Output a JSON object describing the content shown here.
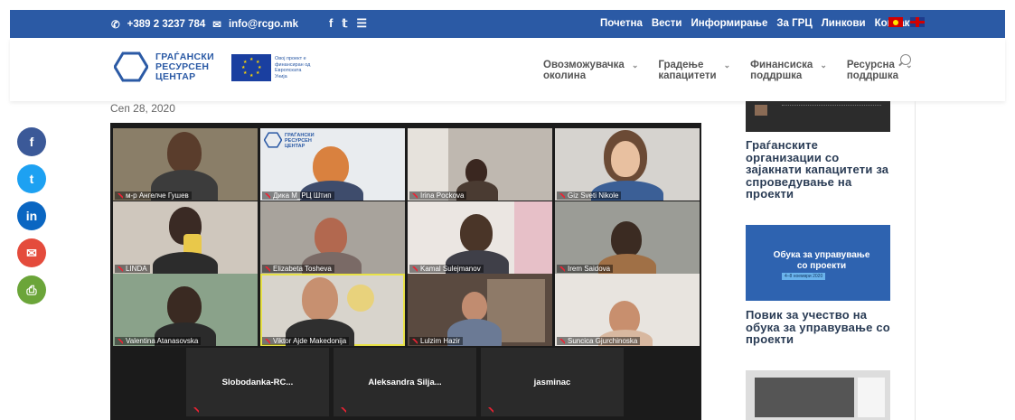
{
  "topbar": {
    "phone": "+389 2 3237 784",
    "email": "info@rcgo.mk",
    "social_icons": [
      "facebook-icon",
      "twitter-icon",
      "rss-icon"
    ],
    "menu": [
      "Почетна",
      "Вести",
      "Информирање",
      "За ГРЦ",
      "Линкови",
      "Контакт"
    ]
  },
  "header": {
    "logo_lines": [
      "ГРАЃАНСКИ",
      "РЕСУРСЕН",
      "ЦЕНТАР"
    ],
    "eu_text": "Овој проект е финансиран од Европската Унија",
    "nav": [
      {
        "line1": "Овозможувачка",
        "line2": "околина"
      },
      {
        "line1": "Градење",
        "line2": "капацитети"
      },
      {
        "line1": "Финансиска",
        "line2": "поддршка"
      },
      {
        "line1": "Ресурсна",
        "line2": "поддршка"
      }
    ]
  },
  "post": {
    "date": "Сеп 28, 2020"
  },
  "video": {
    "tiles": [
      {
        "name": "м-р Ангелче Гушев"
      },
      {
        "name": "Дика М_РЦ Штип",
        "logo": [
          "ГРАЃАНСКИ",
          "РЕСУРСЕН",
          "ЦЕНТАР"
        ]
      },
      {
        "name": "Irina Pockova"
      },
      {
        "name": "Giz Sveti Nikole"
      },
      {
        "name": "LINDA"
      },
      {
        "name": "Elizabeta Tosheva"
      },
      {
        "name": "Kamal Sulejmanov"
      },
      {
        "name": "Irem Saidova"
      },
      {
        "name": "Valentina Atanasovska"
      },
      {
        "name": "Viktor Ajde Makedonija"
      },
      {
        "name": "Lulzim Hazir"
      },
      {
        "name": "Suncica Gjurchinoska"
      }
    ],
    "dark_tiles": [
      "Slobodanka-RC...",
      "Aleksandra Silja...",
      "jasminac"
    ]
  },
  "share_buttons": [
    {
      "label": "f",
      "color": "#3b5998",
      "icon": "facebook-icon"
    },
    {
      "label": "t",
      "color": "#1da1f2",
      "icon": "twitter-icon"
    },
    {
      "label": "in",
      "color": "#0a66c2",
      "icon": "linkedin-icon"
    },
    {
      "label": "✉",
      "color": "#e44b3c",
      "icon": "email-icon"
    },
    {
      "label": "⎙",
      "color": "#6ba539",
      "icon": "print-icon"
    }
  ],
  "sidebar": {
    "post1_title": "Граѓанските организации со зајакнати капацитети за спроведување на проекти",
    "banner_text": "Обука за управување со проекти",
    "banner_date": "4–8 ноември 2020",
    "post2_title": "Повик за учество на обука за управување со проекти"
  },
  "colors": {
    "brand_blue": "#2b5aa5",
    "title_text": "#2a3c55"
  }
}
